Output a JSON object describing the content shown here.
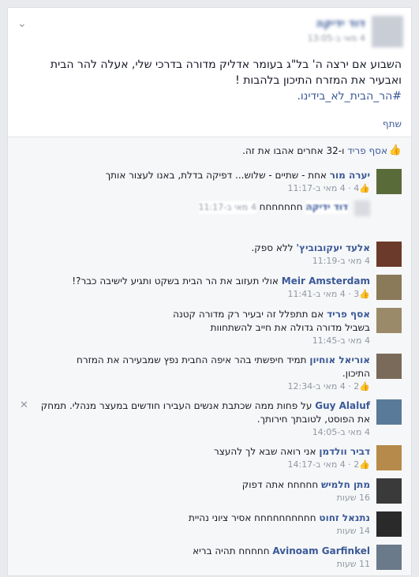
{
  "post": {
    "author": "דוד ידיקה",
    "time": "4 מאי ב-13:05",
    "text_line1": "השבוע אם ירצה ה' בל\"ג בעומר אדליק מדורה בדרכי שלי, אעלה להר הבית",
    "text_line2": "ואבעיר את המזרח התיכון בלהבות !",
    "hashtag": "#הר_הבית_לא_בידינו.",
    "share": "שתף"
  },
  "likes": {
    "name": "אסף פריד",
    "text": "ו-32 אחרים אהבו את זה."
  },
  "comments": [
    {
      "name": "יערה מור",
      "text": "אחת - שתיים - שלוש... דפיקה בדלת, באנו לעצור אותך",
      "time": "4 מאי ב-11:17",
      "likes": "4"
    },
    {
      "name": "דוד ידיקה",
      "text": "חחחחחחח",
      "time": "4 מאי ב-11:17"
    },
    {
      "name": "אלעד יעקובוביץ'",
      "text": "ללא ספק.",
      "time": "4 מאי ב-11:19"
    },
    {
      "name": "Meir Amsterdam",
      "text": "אולי תעזוב את הר הבית בשקט ותגיע לישיבה כבר?!",
      "time": "4 מאי ב-11:41",
      "likes": "3"
    },
    {
      "name": "אסף פריד",
      "text_line1": "אם תתפלל זה יבעיר רק מדורה קטנה",
      "text_line2": "בשביל מדורה גדולה את חייב להשתחוות",
      "time": "4 מאי ב-11:45"
    },
    {
      "name": "אוריאל אוחיון",
      "text_line1": "תמיד חיפשתי בהר איפה החבית נפץ שמבעירה את המזרח",
      "text_line2": "התיכון.",
      "time": "4 מאי ב-12:34",
      "likes": "2"
    },
    {
      "name": "Guy Alaluf",
      "text_line1": "על פחות ממה שכתבת אנשים העבירו חודשים במעצר מנהלי. תמחק",
      "text_line2": "את הפוסט, לטובתך חירותך.",
      "time": "4 מאי ב-14:05"
    },
    {
      "name": "דביר וולדמן",
      "text": "אני רואה שבא לך להעצר",
      "time": "4 מאי ב-14:17",
      "likes": "2"
    },
    {
      "name": "מתן חלמיש",
      "text": "חחחחח אתה דפוק",
      "time": "16 שעות"
    },
    {
      "name": "נתנאל זחוט",
      "text": "חחחחחחחחחח אסיר ציוני נהיית",
      "time": "14 שעות"
    },
    {
      "name": "Avinoam Garfinkel",
      "text": "חחחחח תהיה בריא",
      "time": "11 שעות"
    }
  ],
  "icons": {
    "chevron": "chevron-down-icon",
    "like": "thumbs-up-icon",
    "close": "close-icon"
  },
  "colors": {
    "link": "#3b5998",
    "meta": "#9197a3",
    "bg": "#e9eaed"
  }
}
